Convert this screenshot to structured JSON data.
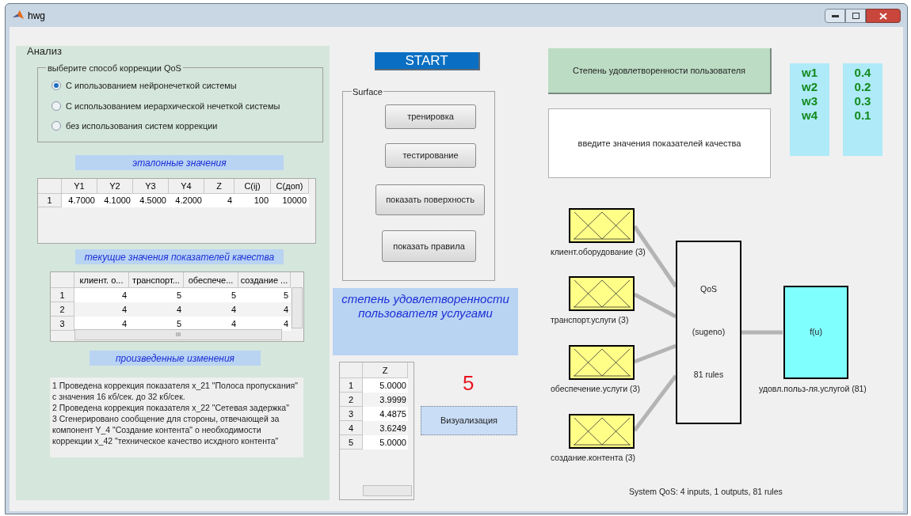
{
  "window": {
    "title": "hwg"
  },
  "analysis": {
    "title": "Анализ",
    "correction_group": {
      "legend": "выберите способ коррекции QoS",
      "options": [
        {
          "label": "С ипользованием нейронечеткой системы",
          "selected": true
        },
        {
          "label": "С использованием иерархической нечеткой системы",
          "selected": false
        },
        {
          "label": "без  использования систем коррекции",
          "selected": false
        }
      ]
    },
    "reference_title": "эталонные значения",
    "reference_table": {
      "columns": [
        "Y1",
        "Y2",
        "Y3",
        "Y4",
        "Z",
        "C(ij)",
        "C(доп)"
      ],
      "rows": [
        {
          "header": "1",
          "cells": [
            "4.7000",
            "4.1000",
            "4.5000",
            "4.2000",
            "4",
            "100",
            "10000"
          ]
        }
      ]
    },
    "current_title": "текущие значения показателей качества",
    "current_table": {
      "columns": [
        "клиент. о...",
        "транспорт...",
        "обеспече...",
        "создание ..."
      ],
      "rows": [
        {
          "header": "1",
          "cells": [
            "4",
            "5",
            "5",
            "5"
          ]
        },
        {
          "header": "2",
          "cells": [
            "4",
            "4",
            "4",
            "4"
          ]
        },
        {
          "header": "3",
          "cells": [
            "4",
            "5",
            "4",
            "4"
          ]
        }
      ],
      "scroll_dots": "III"
    },
    "changes_title": "произведенные изменения",
    "changes_log": [
      "1 Проведена коррекция показателя x_21 \"Полоса пропускания\" с значения 16 кб/сек. до 32 кб/сек.",
      "2 Проведена коррекция показателя x_22 \"Сетевая задержка\"",
      "3 Сгенерировано сообщение для стороны, отвечающей за компонент Y_4 \"Создание контента\" о необходимости коррекции x_42 \"техническое качество исхдного контента\""
    ]
  },
  "start_button": "START",
  "surface": {
    "legend": "Surface",
    "buttons": [
      "тренировка",
      "тестирование",
      "показать поверхность",
      "показать правила"
    ]
  },
  "satisfaction_title": "степень удовлетворенности пользователя услугами",
  "z_table": {
    "columns": [
      "Z"
    ],
    "rows": [
      {
        "header": "1",
        "value": "5.0000"
      },
      {
        "header": "2",
        "value": "3.9999"
      },
      {
        "header": "3",
        "value": "4.4875"
      },
      {
        "header": "4",
        "value": "3.6249"
      },
      {
        "header": "5",
        "value": "5.0000"
      }
    ]
  },
  "result": "5",
  "visualize_button": "Визуализация",
  "satisfaction_button": "Степень удовлетворенности пользователя",
  "input_prompt": "введите значения показателей качества",
  "weights": [
    {
      "name": "w1",
      "value": "0.4"
    },
    {
      "name": "w2",
      "value": "0.2"
    },
    {
      "name": "w3",
      "value": "0.3"
    },
    {
      "name": "w4",
      "value": "0.1"
    }
  ],
  "fis": {
    "inputs": [
      "клиент.оборудование (3)",
      "транспорт.услуги (3)",
      "обеспечение.услуги (3)",
      "создание.контента (3)"
    ],
    "system": [
      "QoS",
      "(sugeno)",
      "81 rules"
    ],
    "output_box": "f(u)",
    "output": "удовл.польз-ля.услугой (81)",
    "summary": "System QoS: 4 inputs, 1 outputs, 81 rules"
  }
}
